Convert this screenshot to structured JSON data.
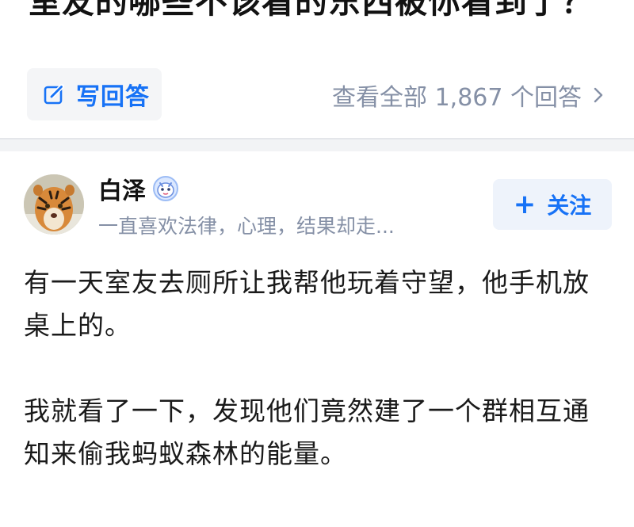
{
  "question": {
    "title": "室友的哪些不该看的东西被你看到了？"
  },
  "actions": {
    "write_answer_label": "写回答",
    "view_all_label": "查看全部 1,867 个回答"
  },
  "author": {
    "name": "白泽",
    "bio": "一直喜欢法律，心理，结果却走..."
  },
  "follow": {
    "plus_symbol": "+",
    "label": "关注"
  },
  "answer": {
    "paragraphs": [
      "有一天室友去厕所让我帮他玩着守望，他手机放桌上的。",
      "我就看了一下，发现他们竟然建了一个群相互通知来偷我蚂蚁森林的能量。"
    ]
  },
  "colors": {
    "accent": "#1772f6",
    "muted": "#8590a6",
    "button_bg": "#f4f5f7",
    "follow_bg": "#eef3fb",
    "divider_bg": "#f2f3f5"
  },
  "icons": {
    "write": "pencil-square-icon",
    "chevron": "chevron-right-icon",
    "badge": "verified-mascot-badge-icon",
    "avatar": "tiger-avatar"
  }
}
